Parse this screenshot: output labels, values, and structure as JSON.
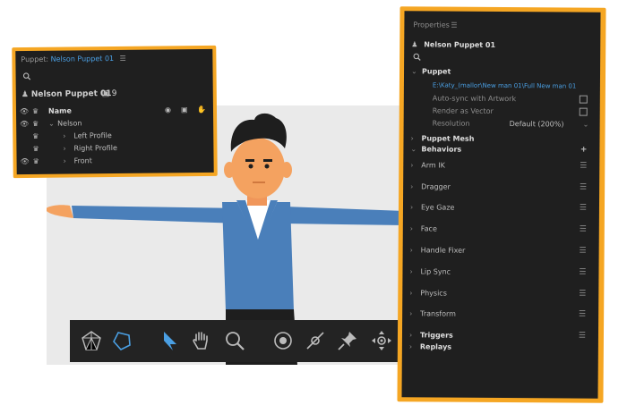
{
  "puppet_panel": {
    "header_prefix": "Puppet:",
    "header_name": "Nelson Puppet 01",
    "title": "Nelson Puppet 01",
    "layer_count": "9",
    "column_name": "Name",
    "layers": [
      "Nelson",
      "Left Profile",
      "Right Profile",
      "Front"
    ]
  },
  "properties_panel": {
    "header": "Properties",
    "puppet_name": "Nelson Puppet 01",
    "section_puppet": "Puppet",
    "path": "E:\\Katy_(mallor\\New man 01\\Full New man 01",
    "auto_sync_label": "Auto-sync with Artwork",
    "render_vector_label": "Render as Vector",
    "resolution_label": "Resolution",
    "resolution_value": "Default (200%)",
    "section_mesh": "Puppet Mesh",
    "section_behaviors": "Behaviors",
    "behaviors": [
      "Arm IK",
      "Dragger",
      "Eye Gaze",
      "Face",
      "Handle Fixer",
      "Lip Sync",
      "Physics",
      "Transform"
    ],
    "section_triggers": "Triggers",
    "section_replays": "Replays"
  },
  "colors": {
    "accent_orange": "#f5a623",
    "panel_bg": "#1f1f1f",
    "link_blue": "#4a9fe3",
    "shirt_blue": "#4a7fba"
  },
  "tools": [
    "mesh-icon",
    "polygon-icon",
    "select-arrow-icon",
    "hand-icon",
    "zoom-icon",
    "handle-icon",
    "stick-icon",
    "pin-icon",
    "move-icon"
  ]
}
